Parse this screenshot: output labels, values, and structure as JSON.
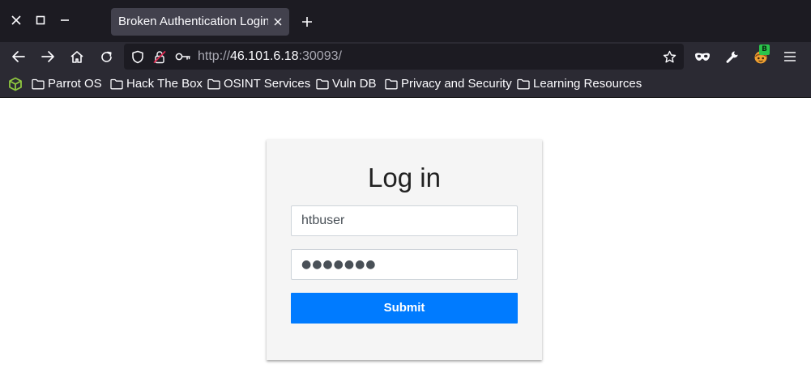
{
  "browser": {
    "tab": {
      "title": "Broken Authentication Login",
      "close_icon": "close-icon"
    },
    "address_bar": {
      "scheme": "http://",
      "host": "46.101.6.18",
      "port_path": ":30093/"
    },
    "icons": {
      "window_close": "close-icon",
      "window_maximize": "maximize-icon",
      "window_minimize": "minimize-icon",
      "new_tab": "plus-icon",
      "back": "arrow-left-icon",
      "forward": "arrow-right-icon",
      "home": "home-icon",
      "reload": "reload-icon",
      "shield": "shield-icon",
      "insecure_lock": "insecure-lock-icon",
      "key": "key-icon",
      "bookmark_star": "star-icon",
      "private_mode": "mask-icon",
      "tools": "wrench-icon",
      "extension": "extension-icon",
      "menu": "hamburger-icon"
    },
    "extension_badge": "B",
    "bookmarks": [
      {
        "label": "Parrot OS"
      },
      {
        "label": "Hack The Box"
      },
      {
        "label": "OSINT Services"
      },
      {
        "label": "Vuln DB"
      },
      {
        "label": "Privacy and Security"
      },
      {
        "label": "Learning Resources"
      }
    ],
    "colors": {
      "chrome_dark": "#1c1b22",
      "chrome": "#2b2a33",
      "tab_active": "#42414d",
      "apps_icon": "#8ec63f"
    }
  },
  "login": {
    "title": "Log in",
    "username_value": "htbuser",
    "password_mask": "●●●●●●●",
    "submit_label": "Submit",
    "colors": {
      "card_bg": "#f5f5f5",
      "button_bg": "#007bff"
    }
  }
}
